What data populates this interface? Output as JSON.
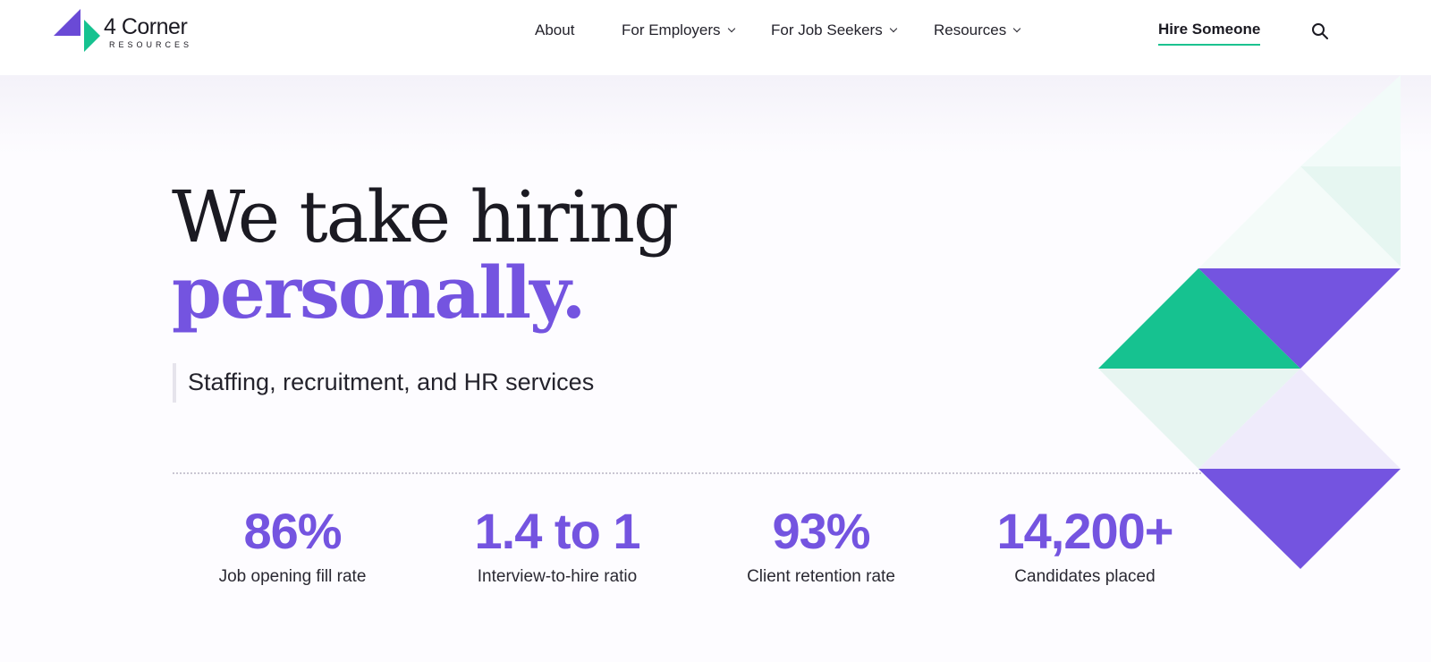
{
  "header": {
    "logo": {
      "name": "4 Corner",
      "sub": "RESOURCES"
    },
    "nav": [
      {
        "label": "About",
        "dropdown": false
      },
      {
        "label": "For Employers",
        "dropdown": true
      },
      {
        "label": "For Job Seekers",
        "dropdown": true
      },
      {
        "label": "Resources",
        "dropdown": true
      }
    ],
    "cta": {
      "label": "Hire Someone"
    },
    "search_icon": "search-icon"
  },
  "hero": {
    "title_line1": "We take hiring",
    "title_line2": "personally.",
    "subtitle": "Staffing, recruitment, and HR services"
  },
  "stats": [
    {
      "value": "86%",
      "label": "Job opening fill rate"
    },
    {
      "value": "1.4 to 1",
      "label": "Interview-to-hire ratio"
    },
    {
      "value": "93%",
      "label": "Client retention rate"
    },
    {
      "value": "14,200+",
      "label": "Candidates placed"
    }
  ],
  "colors": {
    "accent_purple": "#7454e0",
    "accent_green": "#16c290",
    "text": "#1b1a22"
  }
}
